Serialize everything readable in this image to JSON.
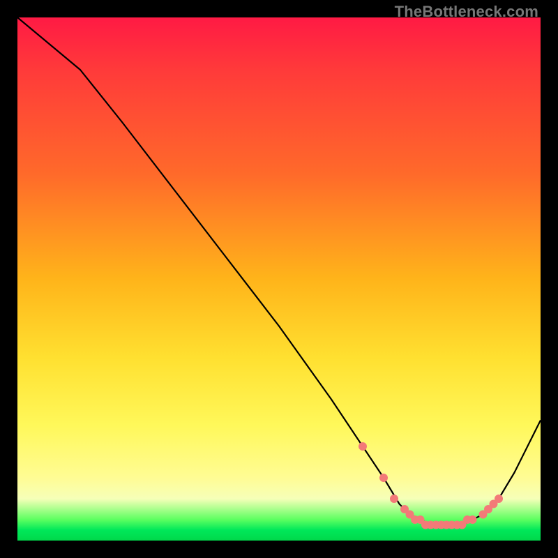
{
  "watermark": "TheBottleneck.com",
  "colors": {
    "frame": "#000000",
    "curve": "#000000",
    "marker": "#f37a78",
    "gradient_top": "#ff1a44",
    "gradient_bottom": "#00d84a"
  },
  "chart_data": {
    "type": "line",
    "title": "",
    "xlabel": "",
    "ylabel": "",
    "xlim": [
      0,
      100
    ],
    "ylim": [
      0,
      100
    ],
    "grid": false,
    "legend": false,
    "series": [
      {
        "name": "bottleneck-curve",
        "x": [
          0,
          6,
          12,
          20,
          30,
          40,
          50,
          60,
          66,
          70,
          73,
          75,
          77,
          79,
          81,
          83,
          85,
          87,
          89,
          92,
          95,
          100
        ],
        "y": [
          100,
          95,
          90,
          80,
          67,
          54,
          41,
          27,
          18,
          12,
          7,
          5,
          4,
          3,
          3,
          3,
          3,
          4,
          5,
          8,
          13,
          23
        ]
      }
    ],
    "markers": {
      "name": "highlighted-points",
      "x": [
        66,
        70,
        72,
        74,
        75,
        76,
        77,
        78,
        79,
        80,
        81,
        82,
        83,
        84,
        85,
        86,
        87,
        89,
        90,
        91,
        92
      ],
      "y": [
        18,
        12,
        8,
        6,
        5,
        4,
        4,
        3,
        3,
        3,
        3,
        3,
        3,
        3,
        3,
        4,
        4,
        5,
        6,
        7,
        8
      ]
    },
    "notes": "Axes are unlabeled in the source image; x and y ranges are normalized to 0–100. The curve descends steeply from top-left with a slight initial knee, reaches a near-zero trough around x≈78–86, and rises toward the right edge. Pink circular markers cluster along the trough region."
  }
}
